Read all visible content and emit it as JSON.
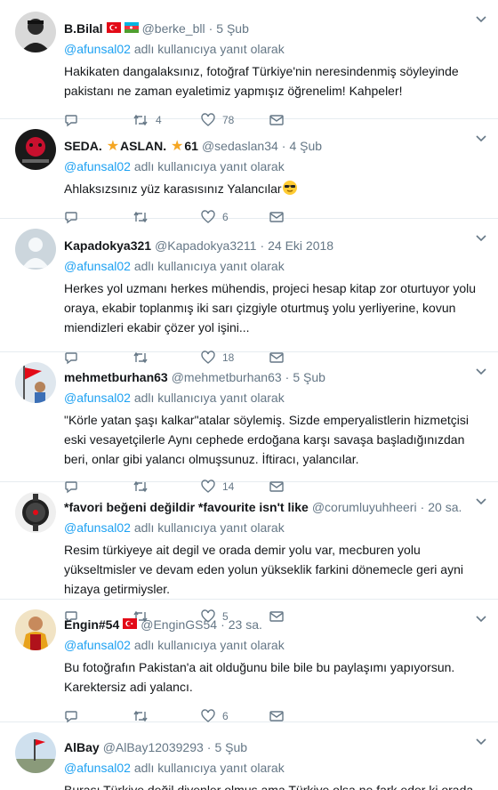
{
  "reply_prefix": "adlı kullanıcıya yanıt olarak",
  "accent": "#1da1f2",
  "tweets": [
    {
      "name": "B.Bilal",
      "flags": [
        "turkey-flag",
        "azerbaijan-flag"
      ],
      "handle": "@berke_bll",
      "time": "5 Şub",
      "mention": "@afunsal02",
      "text": "Hakikaten dangalaksınız, fotoğraf Türkiye'nin neresindenmiş söyleyinde pakistanı ne zaman eyaletimiz yapmışız öğrenelim! Kahpeler!",
      "counts": {
        "reply": "",
        "retweet": "4",
        "like": "78"
      }
    },
    {
      "name_part1": "SEDA.",
      "name_part2": "ASLAN.",
      "name_part3": "61",
      "star": "★",
      "handle": "@sedaslan34",
      "time": "4 Şub",
      "mention": "@afunsal02",
      "text": "Ahlaksızsınız yüz karasısınız Yalancılar",
      "emoji": "sunglasses-emoji",
      "counts": {
        "reply": "",
        "retweet": "",
        "like": "6"
      }
    },
    {
      "name": "Kapadokya321",
      "handle": "@Kapadokya3211",
      "time": "24 Eki 2018",
      "mention": "@afunsal02",
      "text": "Herkes yol uzmanı herkes mühendis, projeci hesap kitap zor oturtuyor yolu oraya, ekabir toplanmış iki sarı çizgiyle oturtmuş yolu yerliyerine, kovun miendizleri ekabir çözer yol işini...",
      "counts": {
        "reply": "",
        "retweet": "",
        "like": "18"
      }
    },
    {
      "name": "mehmetburhan63",
      "handle": "@mehmetburhan63",
      "time": "5 Şub",
      "mention": "@afunsal02",
      "text": "\"Körle yatan şaşı kalkar\"atalar söylemiş. Sizde emperyalistlerin hizmetçisi eski vesayetçilerle Aynı cephede erdoğana karşı savaşa başladığınızdan beri, onlar gibi yalancı olmuşsunuz. İftiracı, yalancılar.",
      "counts": {
        "reply": "",
        "retweet": "",
        "like": "14"
      }
    },
    {
      "name": "*favori beğeni değildir *favourite isn't like",
      "handle": "@corumluyuhheeri",
      "time": "20 sa.",
      "mention": "@afunsal02",
      "text": "Resim türkiyeye ait degil ve orada demir yolu var, mecburen yolu yükseltmisler ve devam eden yolun yükseklik farkini dönemecle geri ayni hizaya getirmiysler.",
      "counts": {
        "reply": "",
        "retweet": "",
        "like": "5"
      }
    },
    {
      "name": "Engin#54",
      "flags": [
        "turkey-flag"
      ],
      "handle": "@EnginGS54",
      "time": "23 sa.",
      "mention": "@afunsal02",
      "text": "Bu fotoğrafın Pakistan'a ait olduğunu bile bile bu paylaşımı yapıyorsun. Karektersiz adi yalancı.",
      "counts": {
        "reply": "",
        "retweet": "",
        "like": "6"
      }
    },
    {
      "name": "AlBay",
      "handle": "@AlBay12039293",
      "time": "5 Şub",
      "mention": "@afunsal02",
      "text": "Burası Türkiye değil diyenler olmuş ama Türkiye olsa ne fark eder ki orada çok"
    }
  ]
}
